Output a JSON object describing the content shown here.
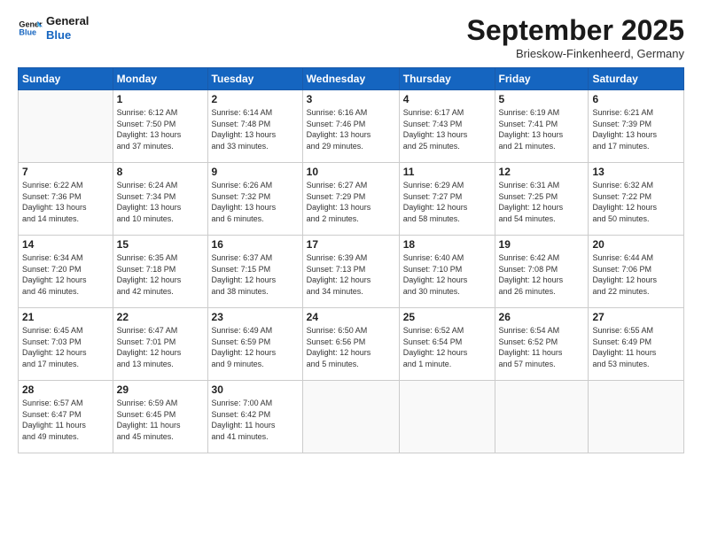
{
  "header": {
    "logo_line1": "General",
    "logo_line2": "Blue",
    "month_title": "September 2025",
    "location": "Brieskow-Finkenheerd, Germany"
  },
  "weekdays": [
    "Sunday",
    "Monday",
    "Tuesday",
    "Wednesday",
    "Thursday",
    "Friday",
    "Saturday"
  ],
  "weeks": [
    [
      {
        "day": "",
        "info": ""
      },
      {
        "day": "1",
        "info": "Sunrise: 6:12 AM\nSunset: 7:50 PM\nDaylight: 13 hours\nand 37 minutes."
      },
      {
        "day": "2",
        "info": "Sunrise: 6:14 AM\nSunset: 7:48 PM\nDaylight: 13 hours\nand 33 minutes."
      },
      {
        "day": "3",
        "info": "Sunrise: 6:16 AM\nSunset: 7:46 PM\nDaylight: 13 hours\nand 29 minutes."
      },
      {
        "day": "4",
        "info": "Sunrise: 6:17 AM\nSunset: 7:43 PM\nDaylight: 13 hours\nand 25 minutes."
      },
      {
        "day": "5",
        "info": "Sunrise: 6:19 AM\nSunset: 7:41 PM\nDaylight: 13 hours\nand 21 minutes."
      },
      {
        "day": "6",
        "info": "Sunrise: 6:21 AM\nSunset: 7:39 PM\nDaylight: 13 hours\nand 17 minutes."
      }
    ],
    [
      {
        "day": "7",
        "info": "Sunrise: 6:22 AM\nSunset: 7:36 PM\nDaylight: 13 hours\nand 14 minutes."
      },
      {
        "day": "8",
        "info": "Sunrise: 6:24 AM\nSunset: 7:34 PM\nDaylight: 13 hours\nand 10 minutes."
      },
      {
        "day": "9",
        "info": "Sunrise: 6:26 AM\nSunset: 7:32 PM\nDaylight: 13 hours\nand 6 minutes."
      },
      {
        "day": "10",
        "info": "Sunrise: 6:27 AM\nSunset: 7:29 PM\nDaylight: 13 hours\nand 2 minutes."
      },
      {
        "day": "11",
        "info": "Sunrise: 6:29 AM\nSunset: 7:27 PM\nDaylight: 12 hours\nand 58 minutes."
      },
      {
        "day": "12",
        "info": "Sunrise: 6:31 AM\nSunset: 7:25 PM\nDaylight: 12 hours\nand 54 minutes."
      },
      {
        "day": "13",
        "info": "Sunrise: 6:32 AM\nSunset: 7:22 PM\nDaylight: 12 hours\nand 50 minutes."
      }
    ],
    [
      {
        "day": "14",
        "info": "Sunrise: 6:34 AM\nSunset: 7:20 PM\nDaylight: 12 hours\nand 46 minutes."
      },
      {
        "day": "15",
        "info": "Sunrise: 6:35 AM\nSunset: 7:18 PM\nDaylight: 12 hours\nand 42 minutes."
      },
      {
        "day": "16",
        "info": "Sunrise: 6:37 AM\nSunset: 7:15 PM\nDaylight: 12 hours\nand 38 minutes."
      },
      {
        "day": "17",
        "info": "Sunrise: 6:39 AM\nSunset: 7:13 PM\nDaylight: 12 hours\nand 34 minutes."
      },
      {
        "day": "18",
        "info": "Sunrise: 6:40 AM\nSunset: 7:10 PM\nDaylight: 12 hours\nand 30 minutes."
      },
      {
        "day": "19",
        "info": "Sunrise: 6:42 AM\nSunset: 7:08 PM\nDaylight: 12 hours\nand 26 minutes."
      },
      {
        "day": "20",
        "info": "Sunrise: 6:44 AM\nSunset: 7:06 PM\nDaylight: 12 hours\nand 22 minutes."
      }
    ],
    [
      {
        "day": "21",
        "info": "Sunrise: 6:45 AM\nSunset: 7:03 PM\nDaylight: 12 hours\nand 17 minutes."
      },
      {
        "day": "22",
        "info": "Sunrise: 6:47 AM\nSunset: 7:01 PM\nDaylight: 12 hours\nand 13 minutes."
      },
      {
        "day": "23",
        "info": "Sunrise: 6:49 AM\nSunset: 6:59 PM\nDaylight: 12 hours\nand 9 minutes."
      },
      {
        "day": "24",
        "info": "Sunrise: 6:50 AM\nSunset: 6:56 PM\nDaylight: 12 hours\nand 5 minutes."
      },
      {
        "day": "25",
        "info": "Sunrise: 6:52 AM\nSunset: 6:54 PM\nDaylight: 12 hours\nand 1 minute."
      },
      {
        "day": "26",
        "info": "Sunrise: 6:54 AM\nSunset: 6:52 PM\nDaylight: 11 hours\nand 57 minutes."
      },
      {
        "day": "27",
        "info": "Sunrise: 6:55 AM\nSunset: 6:49 PM\nDaylight: 11 hours\nand 53 minutes."
      }
    ],
    [
      {
        "day": "28",
        "info": "Sunrise: 6:57 AM\nSunset: 6:47 PM\nDaylight: 11 hours\nand 49 minutes."
      },
      {
        "day": "29",
        "info": "Sunrise: 6:59 AM\nSunset: 6:45 PM\nDaylight: 11 hours\nand 45 minutes."
      },
      {
        "day": "30",
        "info": "Sunrise: 7:00 AM\nSunset: 6:42 PM\nDaylight: 11 hours\nand 41 minutes."
      },
      {
        "day": "",
        "info": ""
      },
      {
        "day": "",
        "info": ""
      },
      {
        "day": "",
        "info": ""
      },
      {
        "day": "",
        "info": ""
      }
    ]
  ]
}
